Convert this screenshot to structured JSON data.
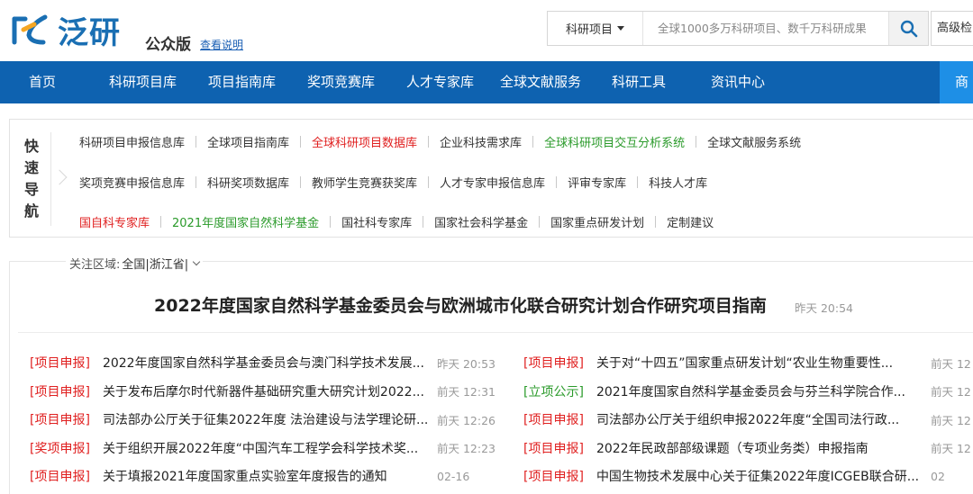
{
  "header": {
    "logo_text": "泛研",
    "edition": "公众版",
    "help_link": "查看说明",
    "search": {
      "category": "科研项目",
      "placeholder": "全球1000多万科研项目、数千万科研成果"
    },
    "advanced_button": "高级检"
  },
  "nav": {
    "items": [
      "首页",
      "科研项目库",
      "项目指南库",
      "奖项竞赛库",
      "人才专家库",
      "全球文献服务",
      "科研工具",
      "资讯中心"
    ],
    "right_item": "商"
  },
  "quick_nav": {
    "label": [
      "快",
      "速",
      "导",
      "航"
    ],
    "rows": [
      [
        {
          "text": "科研项目申报信息库",
          "color": ""
        },
        {
          "text": "全球项目指南库",
          "color": ""
        },
        {
          "text": "全球科研项目数据库",
          "color": "red"
        },
        {
          "text": "企业科技需求库",
          "color": ""
        },
        {
          "text": "全球科研项目交互分析系统",
          "color": "green"
        },
        {
          "text": "全球文献服务系统",
          "color": ""
        }
      ],
      [
        {
          "text": "奖项竞赛申报信息库",
          "color": ""
        },
        {
          "text": "科研奖项数据库",
          "color": ""
        },
        {
          "text": "教师学生竞赛获奖库",
          "color": ""
        },
        {
          "text": "人才专家申报信息库",
          "color": ""
        },
        {
          "text": "评审专家库",
          "color": ""
        },
        {
          "text": "科技人才库",
          "color": ""
        }
      ],
      [
        {
          "text": "国自科专家库",
          "color": "red"
        },
        {
          "text": "2021年度国家自然科学基金",
          "color": "green"
        },
        {
          "text": "国社科专家库",
          "color": ""
        },
        {
          "text": "国家社会科学基金",
          "color": ""
        },
        {
          "text": "国家重点研发计划",
          "color": ""
        },
        {
          "text": "定制建议",
          "color": ""
        }
      ]
    ]
  },
  "main": {
    "region_label": "关注区域:",
    "region_value": "全国|浙江省|",
    "headline": "2022年度国家自然科学基金委员会与欧洲城市化联合研究计划合作研究项目指南",
    "headline_time": "昨天 20:54",
    "left_news": [
      {
        "tag": "[项目申报]",
        "title": "2022年度国家自然科学基金委员会与澳门科学技术发展...",
        "time": "昨天 20:53"
      },
      {
        "tag": "[项目申报]",
        "title": "关于发布后摩尔时代新器件基础研究重大研究计划2022...",
        "time": "前天 12:31"
      },
      {
        "tag": "[项目申报]",
        "title": "司法部办公厅关于征集2022年度 法治建设与法学理论研...",
        "time": "前天 12:26"
      },
      {
        "tag": "[奖项申报]",
        "title": "关于组织开展2022年度“中国汽车工程学会科学技术奖...",
        "time": "前天 12:23"
      },
      {
        "tag": "[项目申报]",
        "title": "关于填报2021年度国家重点实验室年度报告的通知",
        "time": "02-16"
      }
    ],
    "right_news": [
      {
        "tag": "[项目申报]",
        "title": "关于对“十四五”国家重点研发计划“农业生物重要性...",
        "time": "前天 12",
        "tag_color": ""
      },
      {
        "tag": "[立项公示]",
        "title": "2021年度国家自然科学基金委员会与芬兰科学院合作...",
        "time": "前天 12",
        "tag_color": "green"
      },
      {
        "tag": "[项目申报]",
        "title": "司法部办公厅关于组织申报2022年度“全国司法行政...",
        "time": "前天 12",
        "tag_color": ""
      },
      {
        "tag": "[项目申报]",
        "title": "2022年民政部部级课题（专项业务类）申报指南",
        "time": "前天 12",
        "tag_color": ""
      },
      {
        "tag": "[项目申报]",
        "title": "中国生物技术发展中心关于征集2022年度ICGEB联合研...",
        "time": "02",
        "tag_color": ""
      }
    ]
  },
  "colors": {
    "brand_blue": "#0e62b0",
    "nav_highlight": "#1e8fe6",
    "tag_red": "#e02020",
    "tag_green": "#2a9a2a",
    "logo_orange": "#f5a623"
  }
}
